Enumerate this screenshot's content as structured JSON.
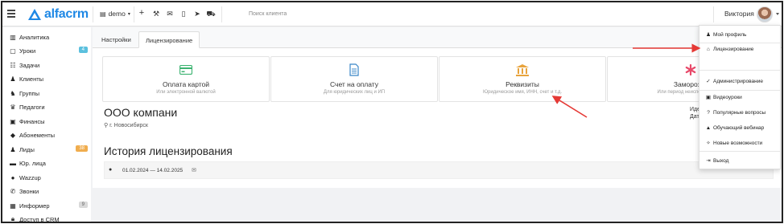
{
  "topbar": {
    "logo": "alfacrm",
    "branch": "demo",
    "search_placeholder": "Поиск клиента",
    "user_name": "Виктория"
  },
  "sidebar": {
    "items": [
      {
        "label": "Аналитика",
        "icon": "chart-icon"
      },
      {
        "label": "Уроки",
        "icon": "calendar-icon",
        "badge": "4",
        "badge_color": "#5bc0de"
      },
      {
        "label": "Задачи",
        "icon": "tasks-icon"
      },
      {
        "label": "Клиенты",
        "icon": "user-icon"
      },
      {
        "label": "Группы",
        "icon": "users-icon"
      },
      {
        "label": "Педагоги",
        "icon": "teacher-icon"
      },
      {
        "label": "Финансы",
        "icon": "money-icon"
      },
      {
        "label": "Абонементы",
        "icon": "tag-icon"
      },
      {
        "label": "Лиды",
        "icon": "lead-icon",
        "badge": "38",
        "badge_color": "#f0ad4e"
      },
      {
        "label": "Юр. лица",
        "icon": "briefcase-icon"
      },
      {
        "label": "Wazzup",
        "icon": "whatsapp-icon"
      },
      {
        "label": "Звонки",
        "icon": "phone-icon"
      },
      {
        "label": "Информер",
        "icon": "informer-icon",
        "badge": "9",
        "badge_color": "#d9d9d9"
      },
      {
        "label": "Доступ в CRM",
        "icon": "lock-icon"
      }
    ]
  },
  "tabs": [
    {
      "label": "Настройки",
      "active": false
    },
    {
      "label": "Лицензирование",
      "active": true
    }
  ],
  "cards": [
    {
      "title": "Оплата картой",
      "subtitle": "Или электронной валютой",
      "icon": "credit-card-icon",
      "color": "#3cb371"
    },
    {
      "title": "Счет на оплату",
      "subtitle": "Для юридических лиц и ИП",
      "icon": "invoice-icon",
      "color": "#3a87c8"
    },
    {
      "title": "Реквизиты",
      "subtitle": "Юридическое имя, ИНН, счет и т.д.",
      "icon": "bank-icon",
      "color": "#e8a33c"
    },
    {
      "title": "Заморозка",
      "subtitle": "Или период неиспользования",
      "icon": "snowflake-icon",
      "color": "#e84a6a"
    }
  ],
  "company": {
    "name": "ООО компани",
    "city": "г. Новосибирск",
    "right_line1": "Иде",
    "right_line2": "Дат"
  },
  "history": {
    "title": "История лицензирования",
    "period": "01.02.2024 — 14.02.2025"
  },
  "dropdown": {
    "items": [
      {
        "label": "Мой профиль",
        "icon": "user-icon"
      },
      {
        "label": "Лицензирование",
        "icon": "lock-icon"
      },
      {
        "label": "Администрирование",
        "icon": "check-icon"
      },
      {
        "label": "Видеоуроки",
        "icon": "video-icon"
      },
      {
        "label": "Популярные вопросы",
        "icon": "question-icon"
      },
      {
        "label": "Обучающий вебинар",
        "icon": "graduation-icon"
      },
      {
        "label": "Новые возможности",
        "icon": "gift-icon"
      },
      {
        "label": "Выход",
        "icon": "logout-icon"
      }
    ]
  },
  "colors": {
    "brand": "#1e88e5",
    "arrow": "#e53935"
  }
}
